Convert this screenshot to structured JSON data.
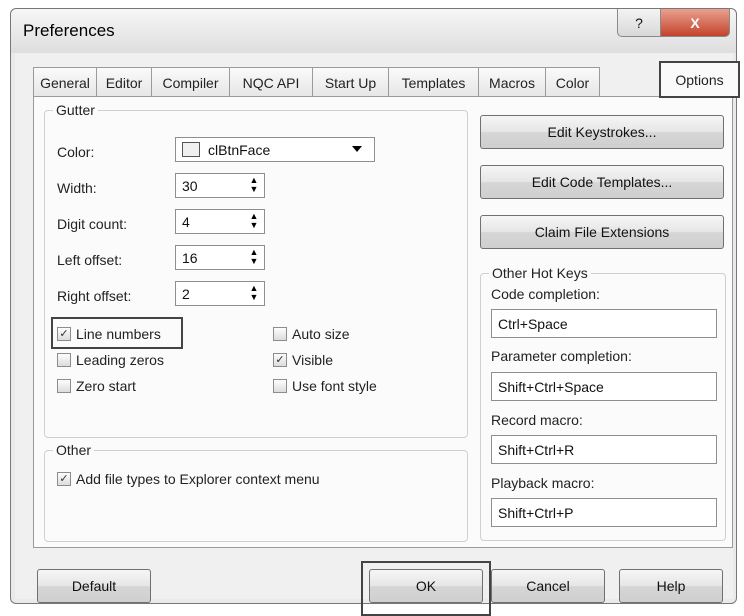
{
  "window": {
    "title": "Preferences",
    "help_glyph": "?",
    "close_glyph": "X"
  },
  "tabs": [
    {
      "label": "General"
    },
    {
      "label": "Editor"
    },
    {
      "label": "Compiler"
    },
    {
      "label": "NQC API"
    },
    {
      "label": "Start Up"
    },
    {
      "label": "Templates"
    },
    {
      "label": "Macros"
    },
    {
      "label": "Color"
    },
    {
      "label": "Options"
    }
  ],
  "active_tab": "Options",
  "gutter": {
    "legend": "Gutter",
    "color_label": "Color:",
    "color_value": "clBtnFace",
    "width_label": "Width:",
    "width_value": "30",
    "digit_label": "Digit count:",
    "digit_value": "4",
    "left_label": "Left offset:",
    "left_value": "16",
    "right_label": "Right offset:",
    "right_value": "2",
    "checks": {
      "line_numbers": {
        "label": "Line numbers",
        "checked": true
      },
      "leading_zeros": {
        "label": "Leading zeros",
        "checked": false
      },
      "zero_start": {
        "label": "Zero start",
        "checked": false
      },
      "auto_size": {
        "label": "Auto size",
        "checked": false
      },
      "visible": {
        "label": "Visible",
        "checked": true
      },
      "use_font_style": {
        "label": "Use font style",
        "checked": false
      }
    }
  },
  "other": {
    "legend": "Other",
    "add_file_types": {
      "label": "Add file types to Explorer context menu",
      "checked": true
    }
  },
  "buttons": {
    "edit_keystrokes": "Edit Keystrokes...",
    "edit_code_templates": "Edit Code Templates...",
    "claim_file_extensions": "Claim File Extensions",
    "default": "Default",
    "ok": "OK",
    "cancel": "Cancel",
    "help": "Help"
  },
  "hotkeys": {
    "legend": "Other Hot Keys",
    "code_completion_label": "Code completion:",
    "code_completion_value": "Ctrl+Space",
    "param_completion_label": "Parameter completion:",
    "param_completion_value": "Shift+Ctrl+Space",
    "record_macro_label": "Record macro:",
    "record_macro_value": "Shift+Ctrl+R",
    "playback_macro_label": "Playback macro:",
    "playback_macro_value": "Shift+Ctrl+P"
  },
  "glyphs": {
    "check": "✓",
    "spin_up": "▲",
    "spin_down": "▼"
  }
}
